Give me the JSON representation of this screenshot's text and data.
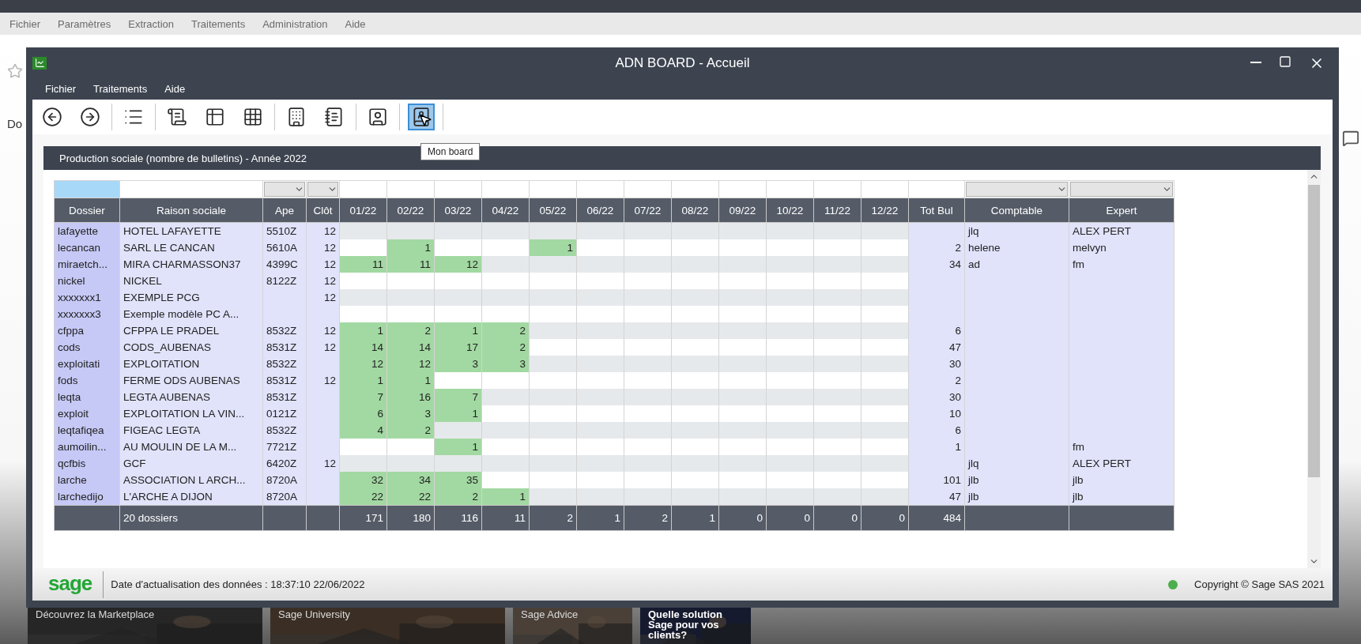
{
  "app": {
    "menu": [
      "Fichier",
      "Paramètres",
      "Extraction",
      "Traitements",
      "Administration",
      "Aide"
    ],
    "heading": "Do"
  },
  "window": {
    "title": "ADN BOARD - Accueil",
    "menu": [
      "Fichier",
      "Traitements",
      "Aide"
    ]
  },
  "toolbar": [
    [
      {
        "kind": "back",
        "selected": false
      },
      {
        "kind": "forward",
        "selected": false
      }
    ],
    [
      {
        "kind": "list",
        "selected": false
      }
    ],
    [
      {
        "kind": "document",
        "selected": false
      },
      {
        "kind": "form",
        "selected": false
      },
      {
        "kind": "grid",
        "selected": false
      }
    ],
    [
      {
        "kind": "building",
        "selected": false
      },
      {
        "kind": "notebook",
        "selected": false
      }
    ],
    [
      {
        "kind": "contact",
        "selected": false
      }
    ],
    [
      {
        "kind": "board",
        "selected": true
      }
    ]
  ],
  "tooltip": "Mon board",
  "panel": {
    "title": "Production sociale (nombre de bulletins) - Année 2022"
  },
  "table": {
    "columns": [
      {
        "label": "Dossier",
        "filter": {
          "kind": "highlighted"
        }
      },
      {
        "label": "Raison sociale",
        "filter": {
          "kind": "input"
        }
      },
      {
        "label": "Ape",
        "filter": {
          "kind": "dropdown"
        }
      },
      {
        "label": "Clôt",
        "filter": {
          "kind": "dropdown"
        }
      },
      {
        "label": "01/22",
        "filter": {
          "kind": "plain"
        }
      },
      {
        "label": "02/22",
        "filter": {
          "kind": "plain"
        }
      },
      {
        "label": "03/22",
        "filter": {
          "kind": "plain"
        }
      },
      {
        "label": "04/22",
        "filter": {
          "kind": "plain"
        }
      },
      {
        "label": "05/22",
        "filter": {
          "kind": "plain"
        }
      },
      {
        "label": "06/22",
        "filter": {
          "kind": "plain"
        }
      },
      {
        "label": "07/22",
        "filter": {
          "kind": "plain"
        }
      },
      {
        "label": "08/22",
        "filter": {
          "kind": "plain"
        }
      },
      {
        "label": "09/22",
        "filter": {
          "kind": "plain"
        }
      },
      {
        "label": "10/22",
        "filter": {
          "kind": "plain"
        }
      },
      {
        "label": "11/22",
        "filter": {
          "kind": "plain"
        }
      },
      {
        "label": "12/22",
        "filter": {
          "kind": "plain"
        }
      },
      {
        "label": "Tot Bul",
        "filter": {
          "kind": "plain"
        }
      },
      {
        "label": "Comptable",
        "filter": {
          "kind": "dropdown"
        }
      },
      {
        "label": "Expert",
        "filter": {
          "kind": "dropdown"
        }
      }
    ],
    "rows": [
      {
        "dossier": "lafayette",
        "raison": "HOTEL LAFAYETTE",
        "ape": "5510Z",
        "clot": "12",
        "comptable": "jlq",
        "expert": "ALEX PERT"
      },
      {
        "dossier": "lecancan",
        "raison": "SARL LE CANCAN",
        "ape": "5610A",
        "clot": "12",
        "months": [
          {
            "filled": false
          },
          {
            "filled": true,
            "value": "1"
          },
          {
            "filled": false
          },
          {
            "filled": false
          },
          {
            "filled": true,
            "value": "1"
          }
        ],
        "tot": "2",
        "comptable": "helene",
        "expert": "melvyn"
      },
      {
        "dossier": "miraetch...",
        "raison": "MIRA  CHARMASSON37",
        "ape": "4399C",
        "clot": "12",
        "months": [
          {
            "filled": true,
            "value": "11"
          },
          {
            "filled": true,
            "value": "11"
          },
          {
            "filled": true,
            "value": "12"
          }
        ],
        "tot": "34",
        "comptable": "ad",
        "expert": "fm"
      },
      {
        "dossier": "nickel",
        "raison": "NICKEL",
        "ape": "8122Z",
        "clot": "12"
      },
      {
        "dossier": "xxxxxxx1",
        "raison": "EXEMPLE PCG",
        "clot": "12"
      },
      {
        "dossier": "xxxxxxx3",
        "raison": "Exemple modèle PC A..."
      },
      {
        "dossier": "cfppa",
        "raison": "CFPPA LE PRADEL",
        "ape": "8532Z",
        "clot": "12",
        "months": [
          {
            "filled": true,
            "value": "1"
          },
          {
            "filled": true,
            "value": "2"
          },
          {
            "filled": true,
            "value": "1"
          },
          {
            "filled": true,
            "value": "2"
          }
        ],
        "tot": "6"
      },
      {
        "dossier": "cods",
        "raison": "CODS_AUBENAS",
        "ape": "8531Z",
        "clot": "12",
        "months": [
          {
            "filled": true,
            "value": "14"
          },
          {
            "filled": true,
            "value": "14"
          },
          {
            "filled": true,
            "value": "17"
          },
          {
            "filled": true,
            "value": "2"
          }
        ],
        "tot": "47"
      },
      {
        "dossier": "exploitati",
        "raison": "EXPLOITATION",
        "ape": "8532Z",
        "months": [
          {
            "filled": true,
            "value": "12"
          },
          {
            "filled": true,
            "value": "12"
          },
          {
            "filled": true,
            "value": "3"
          },
          {
            "filled": true,
            "value": "3"
          }
        ],
        "tot": "30"
      },
      {
        "dossier": "fods",
        "raison": "FERME ODS AUBENAS",
        "ape": "8531Z",
        "clot": "12",
        "months": [
          {
            "filled": true,
            "value": "1"
          },
          {
            "filled": true,
            "value": "1"
          }
        ],
        "tot": "2"
      },
      {
        "dossier": "leqta",
        "raison": "LEGTA AUBENAS",
        "ape": "8531Z",
        "months": [
          {
            "filled": true,
            "value": "7"
          },
          {
            "filled": true,
            "value": "16"
          },
          {
            "filled": true,
            "value": "7"
          }
        ],
        "tot": "30"
      },
      {
        "dossier": "exploit",
        "raison": "EXPLOITATION LA VIN...",
        "ape": "0121Z",
        "months": [
          {
            "filled": true,
            "value": "6"
          },
          {
            "filled": true,
            "value": "3"
          },
          {
            "filled": true,
            "value": "1"
          }
        ],
        "tot": "10"
      },
      {
        "dossier": "leqtafiqea",
        "raison": "FIGEAC LEGTA",
        "ape": "8532Z",
        "months": [
          {
            "filled": true,
            "value": "4"
          },
          {
            "filled": true,
            "value": "2"
          }
        ],
        "tot": "6"
      },
      {
        "dossier": "aumoilin...",
        "raison": "AU MOULIN DE LA M...",
        "ape": "7721Z",
        "months": [
          {
            "filled": false
          },
          {
            "filled": false
          },
          {
            "filled": true,
            "value": "1"
          }
        ],
        "tot": "1",
        "expert": "fm"
      },
      {
        "dossier": "qcfbis",
        "raison": "GCF",
        "ape": "6420Z",
        "clot": "12",
        "comptable": "jlq",
        "expert": "ALEX PERT"
      },
      {
        "dossier": "larche",
        "raison": "ASSOCIATION L ARCH...",
        "ape": "8720A",
        "months": [
          {
            "filled": true,
            "value": "32"
          },
          {
            "filled": true,
            "value": "34"
          },
          {
            "filled": true,
            "value": "35"
          }
        ],
        "tot": "101",
        "comptable": "jlb",
        "expert": "jlb"
      },
      {
        "dossier": "larchedijo",
        "raison": "L'ARCHE A DIJON",
        "ape": "8720A",
        "months": [
          {
            "filled": true,
            "value": "22"
          },
          {
            "filled": true,
            "value": "22"
          },
          {
            "filled": true,
            "value": "2"
          },
          {
            "filled": true,
            "value": "1"
          }
        ],
        "tot": "47",
        "comptable": "jlb",
        "expert": "jlb"
      }
    ],
    "footer": {
      "label": "20 dossiers",
      "totals": [
        "171",
        "180",
        "116",
        "11",
        "2",
        "1",
        "2",
        "1",
        "0",
        "0",
        "0",
        "0"
      ],
      "tot": "484"
    }
  },
  "status_bar": {
    "logo": "sage",
    "date": "Date d'actualisation des données : 18:37:10 22/06/2022",
    "copyright": "Copyright © Sage SAS 2021"
  },
  "tiles": [
    "Découvrez la Marketplace",
    "Sage University",
    "Sage Advice",
    "Quelle solution Sage pour vos clients?"
  ]
}
